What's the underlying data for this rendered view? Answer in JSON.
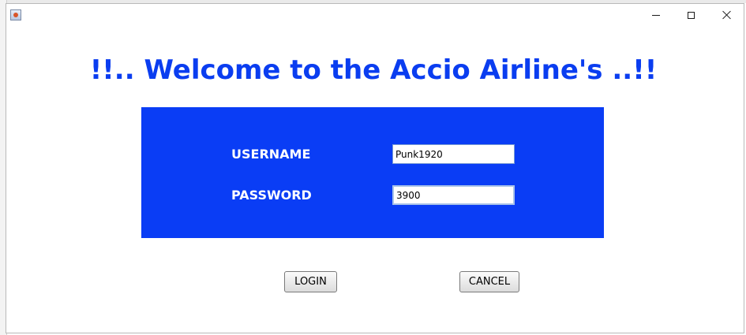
{
  "window": {
    "title": "",
    "icon": "java-app-icon",
    "controls": {
      "minimize": "minimize-icon",
      "maximize": "maximize-icon",
      "close": "close-icon"
    }
  },
  "heading": "!!.. Welcome to the Accio Airline's ..!!",
  "login_panel": {
    "username_label": "USERNAME",
    "username_value": "Punk1920",
    "password_label": "PASSWORD",
    "password_value": "3900"
  },
  "buttons": {
    "login": "LOGIN",
    "cancel": "CANCEL"
  },
  "colors": {
    "heading": "#0a3df0",
    "panel": "#0a3df5",
    "label_text": "#ffffff"
  }
}
